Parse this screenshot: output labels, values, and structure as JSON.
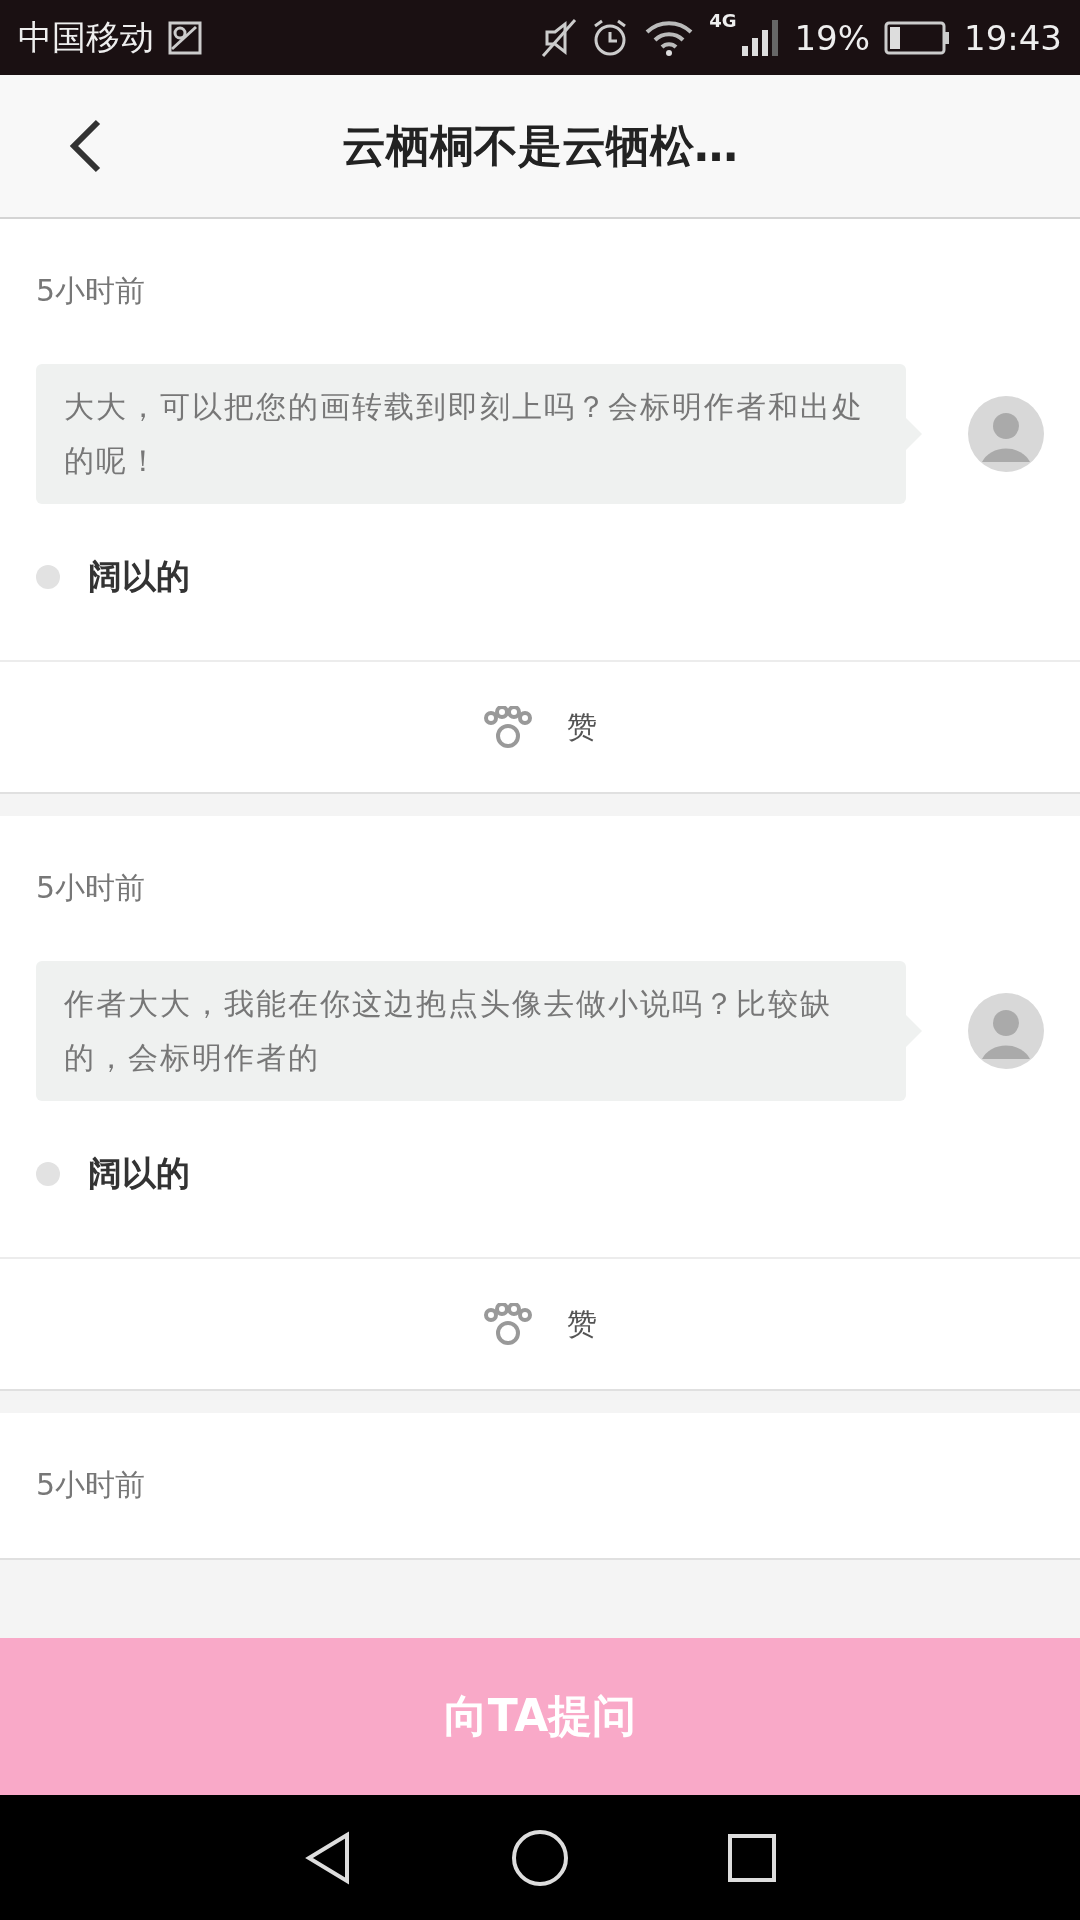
{
  "status_bar": {
    "carrier": "中国移动",
    "network": "4G",
    "battery": "19%",
    "time": "19:43"
  },
  "header": {
    "title": "云栖桐不是云牺松…"
  },
  "questions": [
    {
      "time": "5小时前",
      "question": "大大，可以把您的画转载到即刻上吗？会标明作者和出处的呢！",
      "answer": "阔以的",
      "like_label": "赞"
    },
    {
      "time": "5小时前",
      "question": "作者大大，我能在你这边抱点头像去做小说吗？比较缺的，会标明作者的",
      "answer": "阔以的",
      "like_label": "赞"
    },
    {
      "time": "5小时前"
    }
  ],
  "ask_button": {
    "label": "向TA提问"
  }
}
